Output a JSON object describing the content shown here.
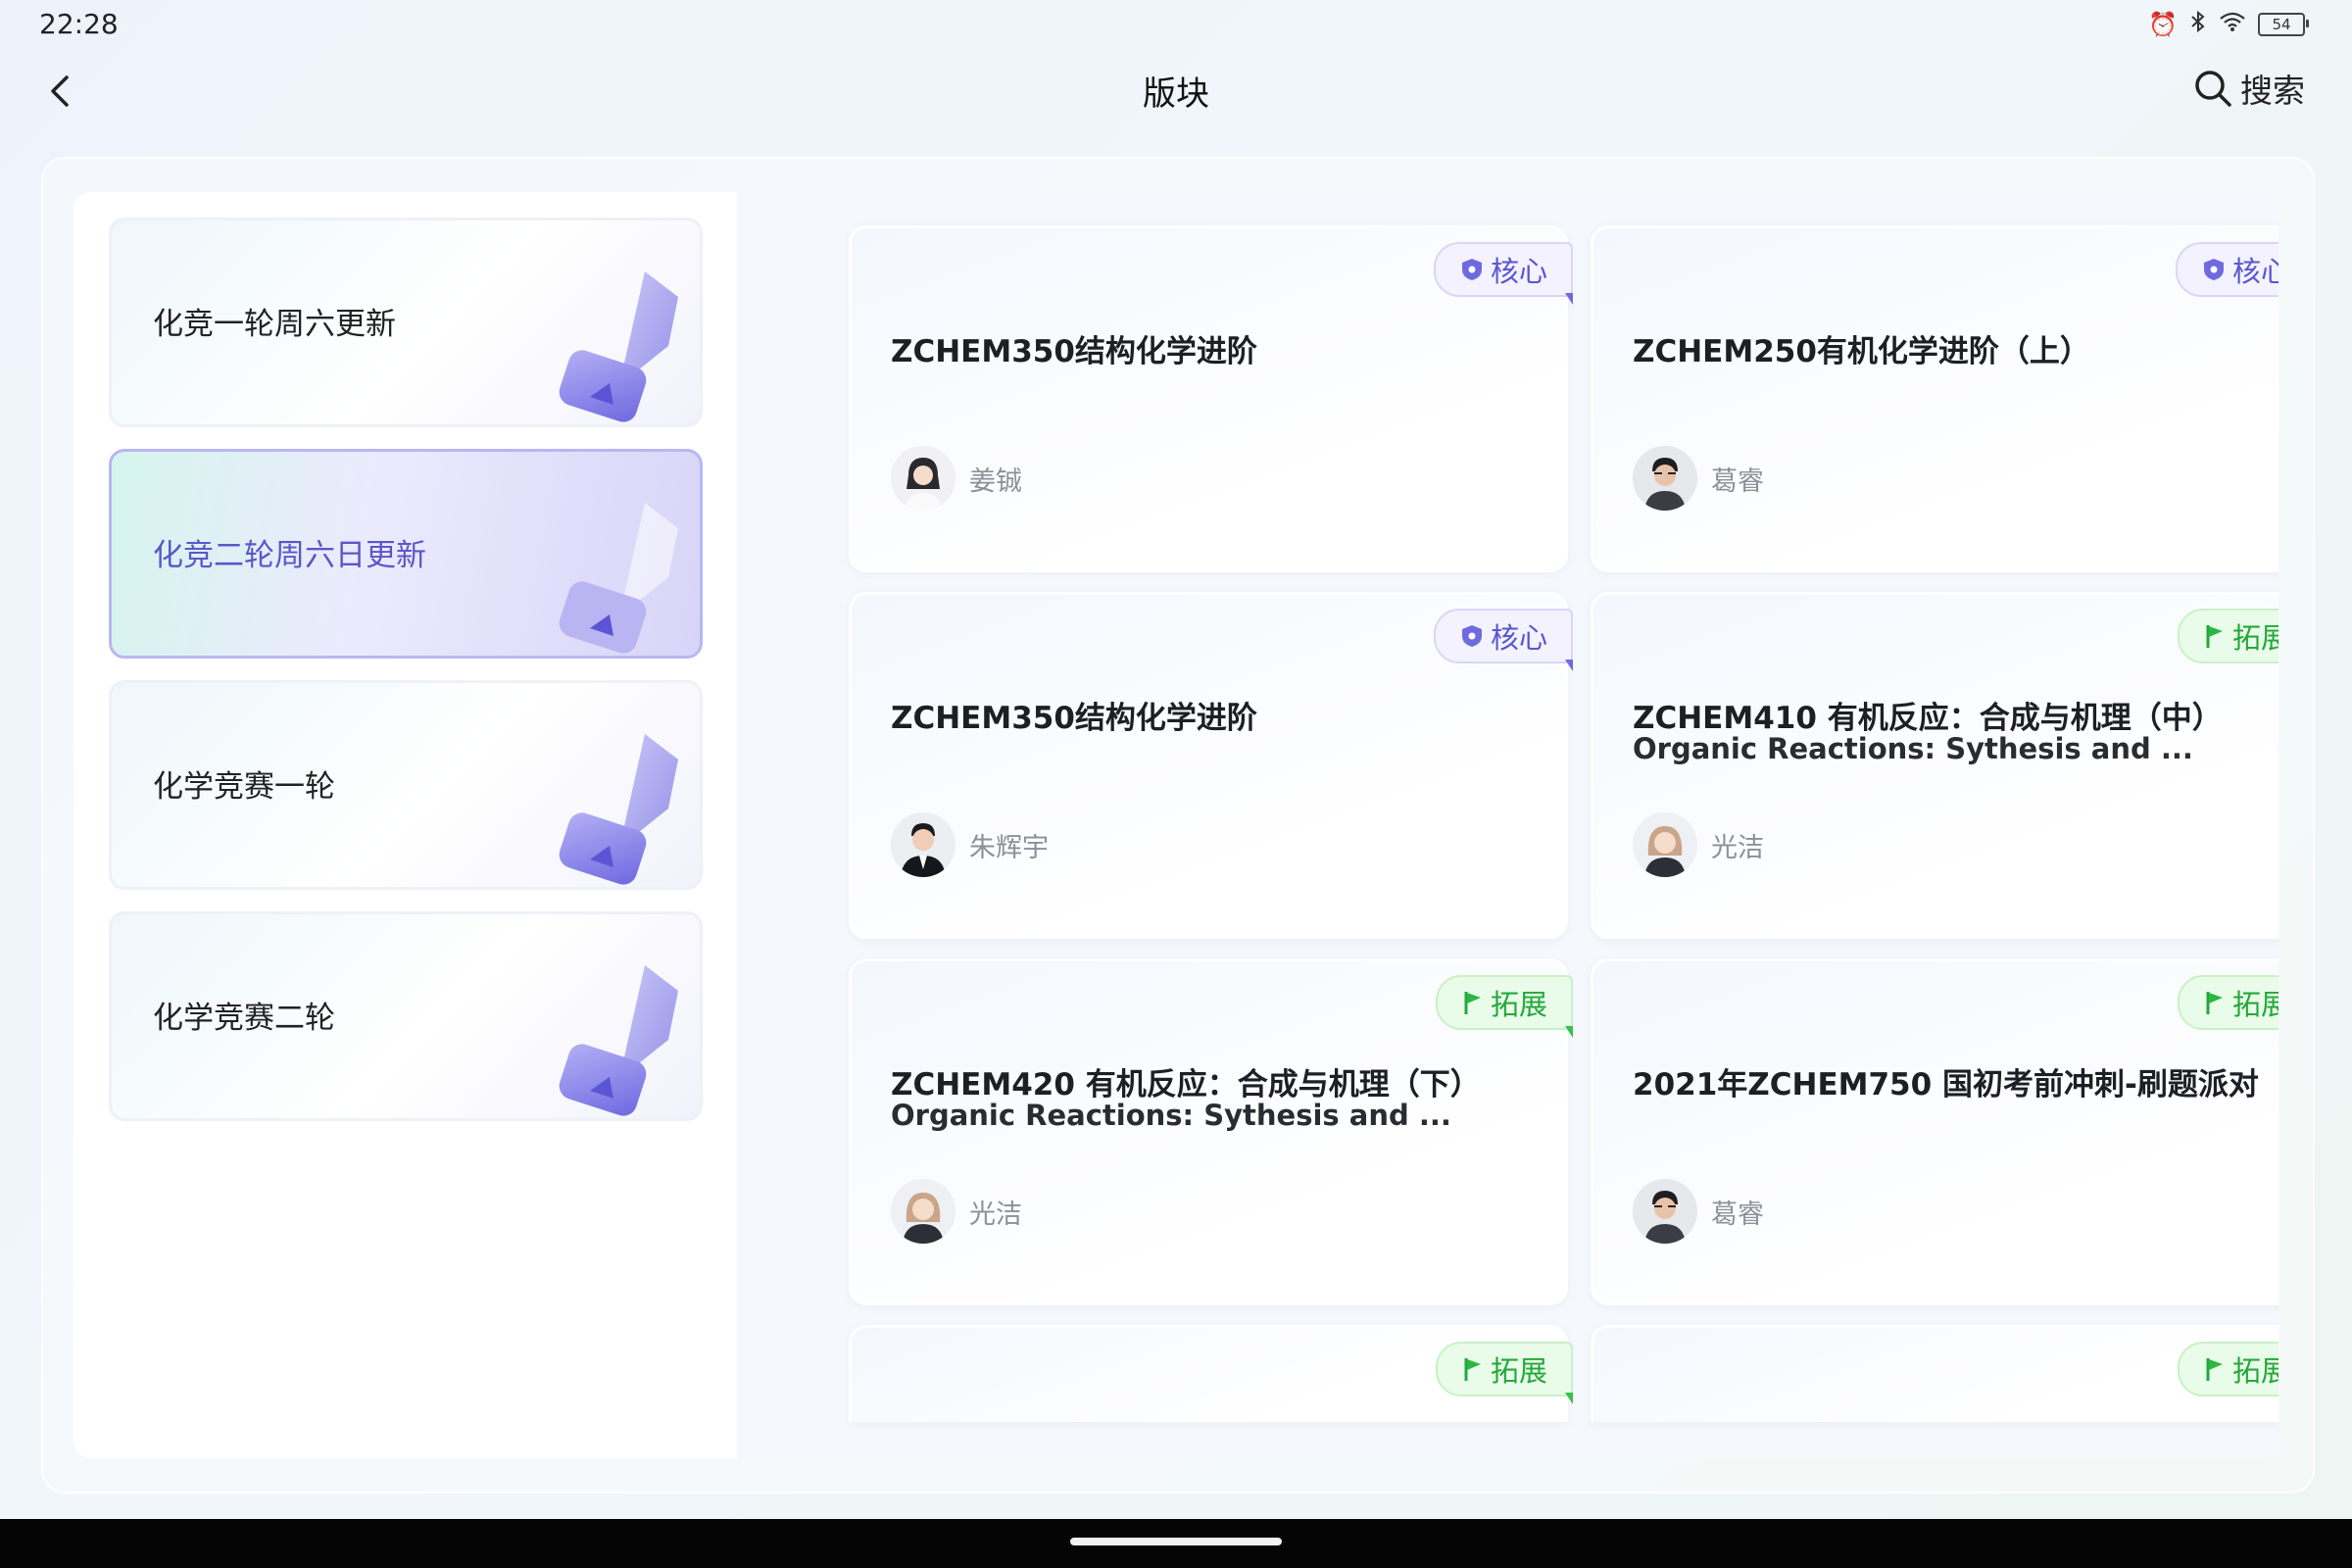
{
  "status_bar": {
    "time": "22:28",
    "battery": "54"
  },
  "nav": {
    "title": "版块",
    "search_label": "搜索"
  },
  "sidebar": {
    "items": [
      {
        "label": "化竞一轮周六更新",
        "active": false
      },
      {
        "label": "化竞二轮周六日更新",
        "active": true
      },
      {
        "label": "化学竞赛一轮",
        "active": false
      },
      {
        "label": "化学竞赛二轮",
        "active": false
      }
    ]
  },
  "courses": [
    {
      "title": "ZCHEM350结构化学进阶",
      "subtitle": "",
      "author": "姜铖",
      "tag": "核心",
      "tag_type": "core"
    },
    {
      "title": "ZCHEM250有机化学进阶（上）",
      "subtitle": "",
      "author": "葛睿",
      "tag": "核心",
      "tag_type": "core"
    },
    {
      "title": "ZCHEM350结构化学进阶",
      "subtitle": "",
      "author": "朱辉宇",
      "tag": "核心",
      "tag_type": "core"
    },
    {
      "title": "ZCHEM410 有机反应：合成与机理（中）",
      "subtitle": "Organic Reactions: Sythesis and ...",
      "author": "光洁",
      "tag": "拓展",
      "tag_type": "ext"
    },
    {
      "title": "ZCHEM420 有机反应：合成与机理（下）",
      "subtitle": "Organic Reactions: Sythesis and ...",
      "author": "光洁",
      "tag": "拓展",
      "tag_type": "ext"
    },
    {
      "title": "2021年ZCHEM750 国初考前冲刺-刷题派对",
      "subtitle": "",
      "author": "葛睿",
      "tag": "拓展",
      "tag_type": "ext"
    },
    {
      "tag": "拓展",
      "tag_type": "ext"
    },
    {
      "tag": "拓展",
      "tag_type": "ext"
    }
  ],
  "colors": {
    "core_accent": "#5a55d0",
    "ext_accent": "#24a83a",
    "active_sidebar": "#5c56c9"
  }
}
